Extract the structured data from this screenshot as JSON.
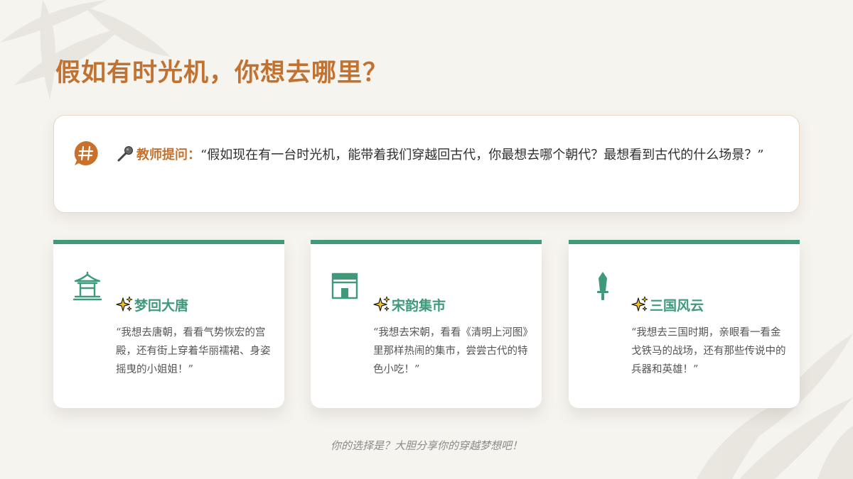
{
  "slide": {
    "title": "假如有时光机，你想去哪里？",
    "question": {
      "label": "教师提问：",
      "text": "“假如现在有一台时光机，能带着我们穿越回古代，你最想去哪个朝代？最想看到古代的什么场景？”"
    },
    "options": [
      {
        "title": "梦回大唐",
        "desc": "“我想去唐朝，看看气势恢宏的宫殿，还有街上穿着华丽襦裙、身姿摇曳的小姐姐！”",
        "icon": "pavilion-icon"
      },
      {
        "title": "宋韵集市",
        "desc": "“我想去宋朝，看看《清明上河图》里那样热闹的集市，尝尝古代的特色小吃！”",
        "icon": "storefront-icon"
      },
      {
        "title": "三国风云",
        "desc": "“我想去三国时期，亲眼看一看金戈铁马的战场，还有那些传说中的兵器和英雄！”",
        "icon": "sword-icon"
      }
    ],
    "footer": "你的选择是？大胆分享你的穿越梦想吧！"
  },
  "colors": {
    "title": "#c27230",
    "accent_green": "#3f9a79",
    "background": "#f6f4ef",
    "badge": "#c9702b"
  }
}
